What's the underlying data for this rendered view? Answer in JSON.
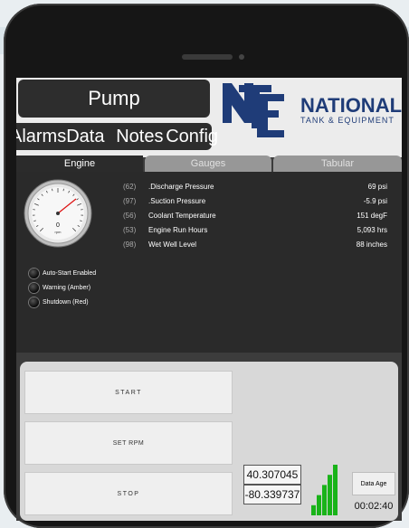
{
  "header": {
    "title": "Pump"
  },
  "nav": {
    "alarms": "Alarms",
    "data": "Data",
    "notes": "Notes",
    "config": "Config"
  },
  "logo": {
    "line1": "NATIONAL",
    "line2": "TANK & EQUIPMENT",
    "mark": "NTE"
  },
  "tabs": [
    {
      "label": "Engine",
      "active": true
    },
    {
      "label": "Gauges",
      "active": false
    },
    {
      "label": "Tabular",
      "active": false
    }
  ],
  "gauge": {
    "value": "0",
    "unit": "rpm"
  },
  "readings": [
    {
      "code": "(62)",
      "label": ".Discharge Pressure",
      "value": "69 psi"
    },
    {
      "code": "(97)",
      "label": ".Suction Pressure",
      "value": "-5.9 psi"
    },
    {
      "code": "(56)",
      "label": "Coolant Temperature",
      "value": "151 degF"
    },
    {
      "code": "(53)",
      "label": "Engine Run Hours",
      "value": "5,093 hrs"
    },
    {
      "code": "(98)",
      "label": "Wet Well Level",
      "value": "88 inches"
    }
  ],
  "indicators": [
    {
      "label": "Auto-Start Enabled"
    },
    {
      "label": "Warning (Amber)"
    },
    {
      "label": "Shutdown (Red)"
    }
  ],
  "controls": {
    "start": "START",
    "set_rpm": "SET RPM",
    "stop": "STOP"
  },
  "location": {
    "lat": "40.307045",
    "lon": "-80.339737"
  },
  "signal": {
    "bars": 5,
    "level": 1.0,
    "color": "#19b319"
  },
  "data_age": {
    "label": "Data Age",
    "value": "00:02:40"
  }
}
